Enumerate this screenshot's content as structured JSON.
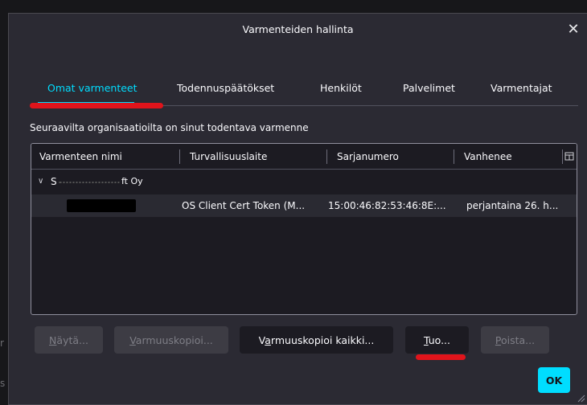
{
  "dialog": {
    "title": "Varmenteiden hallinta",
    "close_glyph": "✕"
  },
  "tabs": [
    {
      "label": "Omat varmenteet",
      "selected": true
    },
    {
      "label": "Todennuspäätökset",
      "selected": false
    },
    {
      "label": "Henkilöt",
      "selected": false
    },
    {
      "label": "Palvelimet",
      "selected": false
    },
    {
      "label": "Varmentajat",
      "selected": false
    }
  ],
  "caption": "Seuraavilta organisaatioilta on sinut todentava varmenne",
  "tree": {
    "columns": [
      "Varmenteen nimi",
      "Turvallisuuslaite",
      "Sarjanumero",
      "Vanhenee"
    ],
    "group_label": "S",
    "group_label_tail": "ft Oy",
    "rows": [
      {
        "name": "",
        "device": "OS Client Cert Token (M...",
        "serial": "15:00:46:82:53:46:8E:...",
        "expires": "perjantaina 26. h..."
      }
    ]
  },
  "buttons": {
    "view": "Näytä...",
    "backup": "Varmuuskopioi...",
    "backup_all": "Varmuuskopioi kaikki...",
    "import": "Tuo...",
    "delete": "Poista...",
    "ok": "OK"
  },
  "colors": {
    "accent": "#00ddff",
    "annotation": "#e0141b",
    "dialog_bg": "#2b2a33",
    "tree_bg": "#1c1b22"
  },
  "icons": {
    "close": "close-icon",
    "twisty": "chevron-down-icon",
    "column_picker": "column-picker-icon"
  }
}
